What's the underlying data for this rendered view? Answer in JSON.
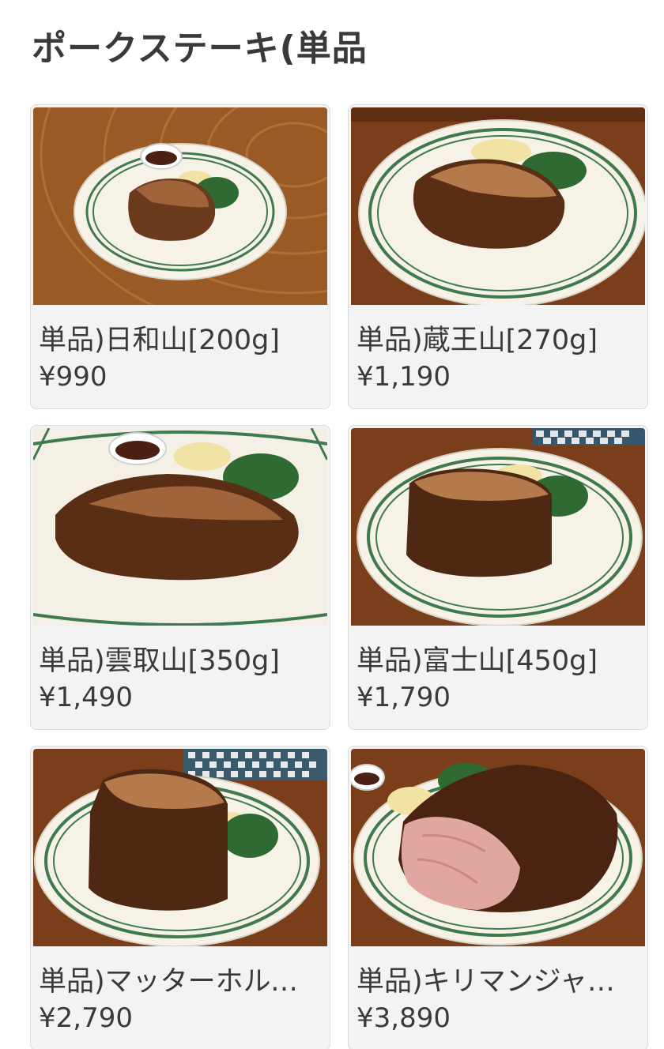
{
  "header": {
    "title": "ポークステーキ(単品"
  },
  "items": [
    {
      "name": "単品)日和山[200g]",
      "price": "¥990",
      "image": "steak-photo-small-plate-with-sauce"
    },
    {
      "name": "単品)蔵王山[270g]",
      "price": "¥1,190",
      "image": "steak-photo-thick-slab"
    },
    {
      "name": "単品)雲取山[350g]",
      "price": "¥1,490",
      "image": "steak-photo-large-flat-with-sauce"
    },
    {
      "name": "単品)富士山[450g]",
      "price": "¥1,790",
      "image": "steak-photo-tall-block"
    },
    {
      "name": "単品)マッターホルン…",
      "price": "¥2,790",
      "image": "steak-photo-tall-roast"
    },
    {
      "name": "単品)キリマンジャロ…",
      "price": "¥3,890",
      "image": "steak-photo-giant-roast-pink-inside"
    }
  ],
  "colors": {
    "card_background": "#f3f3f3",
    "text": "#3a3a3a",
    "wood": "#8a4f22",
    "plate": "#f5f1e6",
    "plate_rim_stripe": "#3f7a4e",
    "meat": "#6b3a1c"
  }
}
